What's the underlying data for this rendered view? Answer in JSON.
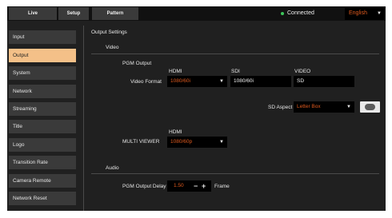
{
  "header": {
    "tabs": [
      {
        "label": "Live"
      },
      {
        "label": "Setup"
      },
      {
        "label": "Pattern"
      }
    ],
    "status": "Connected",
    "status_color": "#3cc45a",
    "language": "English",
    "language_icon": "chevron-down-icon"
  },
  "sidebar": {
    "items": [
      {
        "label": "Input"
      },
      {
        "label": "Output"
      },
      {
        "label": "System"
      },
      {
        "label": "Network"
      },
      {
        "label": "Streaming"
      },
      {
        "label": "Title"
      },
      {
        "label": "Logo"
      },
      {
        "label": "Transition Rate"
      },
      {
        "label": "Camera Remote"
      },
      {
        "label": "Network Reset"
      }
    ],
    "active": "Output",
    "active_color": "#f4c088"
  },
  "main": {
    "title": "Output Settings",
    "video": {
      "title": "Video",
      "pgm_output_label": "PGM Output",
      "hdmi_head": "HDMI",
      "sdi_head": "SDI",
      "video_head": "VIDEO",
      "video_format_label": "Video Format",
      "hdmi_value": "1080/60i",
      "sdi_value": "1080/60i",
      "video_value": "SD",
      "sd_aspect_label": "SD Aspect",
      "sd_aspect_value": "Letter Box",
      "multiviewer_hdmi_head": "HDMI",
      "multiviewer_label": "MULTI VIEWER",
      "multiviewer_value": "1080/60p"
    },
    "audio": {
      "title": "Audio",
      "delay_label": "PGM Output Delay",
      "delay_value": "1.50",
      "minus_label": "−",
      "plus_label": "+",
      "unit": "Frame"
    }
  },
  "colors": {
    "accent_orange": "#e05a1e",
    "background": "#202020",
    "panel": "#3a3a3a"
  }
}
